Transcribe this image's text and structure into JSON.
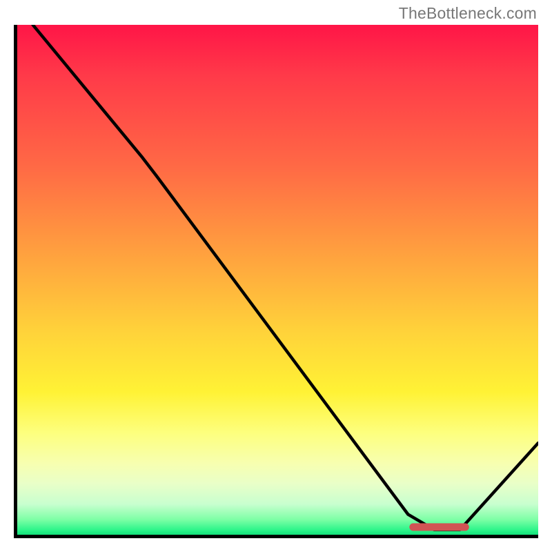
{
  "watermark_text": "TheBottleneck.com",
  "chart_data": {
    "type": "line",
    "title": "",
    "xlabel": "",
    "ylabel": "",
    "xlim": [
      0,
      100
    ],
    "ylim": [
      0,
      100
    ],
    "background_gradient": [
      {
        "offset": 0,
        "color": "#ff1547"
      },
      {
        "offset": 50,
        "color": "#ffd23a"
      },
      {
        "offset": 80,
        "color": "#fdff7e"
      },
      {
        "offset": 100,
        "color": "#13e07a"
      }
    ],
    "curve": [
      {
        "x": 3,
        "y": 100
      },
      {
        "x": 24,
        "y": 74
      },
      {
        "x": 27,
        "y": 70
      },
      {
        "x": 75,
        "y": 4
      },
      {
        "x": 80,
        "y": 1
      },
      {
        "x": 85,
        "y": 1
      },
      {
        "x": 100,
        "y": 18
      }
    ],
    "marker_segment": {
      "x0": 76,
      "x1": 86,
      "y": 1.5
    }
  },
  "coords": {
    "inner_w": 755,
    "inner_h": 739
  }
}
